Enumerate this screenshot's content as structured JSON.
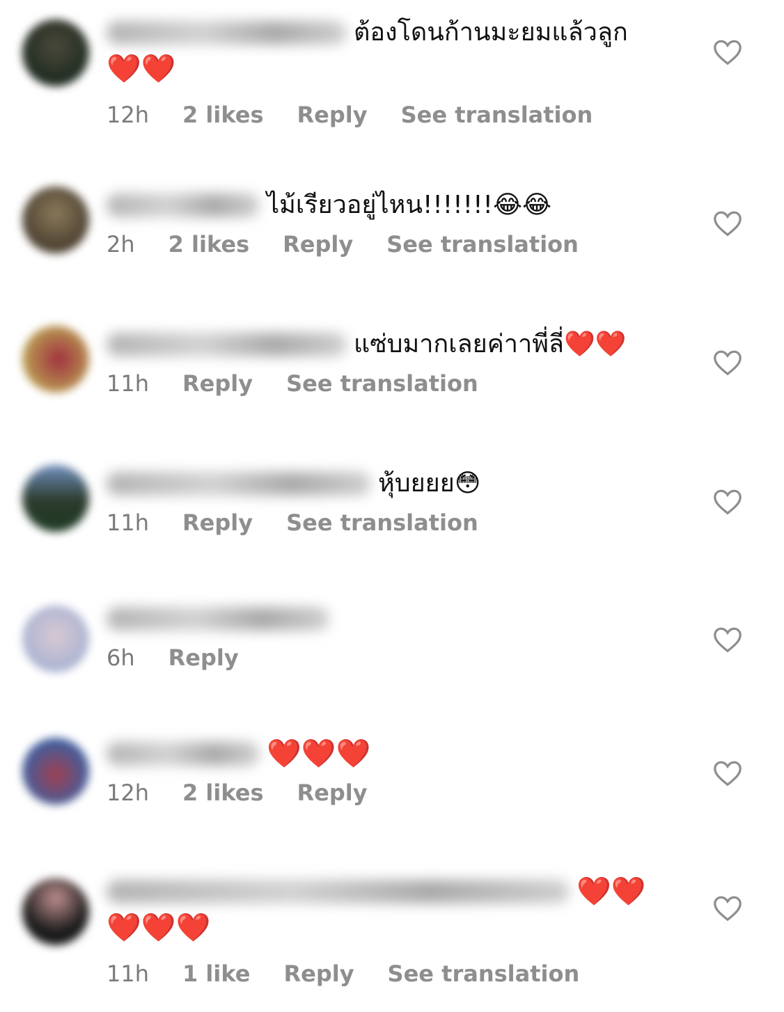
{
  "comments": [
    {
      "text": "ต้องโดนก้านมะยมแล้วลูก",
      "emoji_line": "❤️❤️",
      "time": "12h",
      "likes": "2 likes",
      "reply": "Reply",
      "translate": "See translation"
    },
    {
      "text": "ไม้เรียวอยู่ไหน!!!!!!!😂😂",
      "time": "2h",
      "likes": "2 likes",
      "reply": "Reply",
      "translate": "See translation"
    },
    {
      "text": "แซ่บมากเลยค่าาพี่ลี่❤️❤️",
      "time": "11h",
      "reply": "Reply",
      "translate": "See translation"
    },
    {
      "text": "หุ้บยยย😳",
      "time": "11h",
      "reply": "Reply",
      "translate": "See translation"
    },
    {
      "text": "",
      "time": "6h",
      "reply": "Reply"
    },
    {
      "text": "❤️❤️❤️",
      "time": "12h",
      "likes": "2 likes",
      "reply": "Reply"
    },
    {
      "text": "❤️❤️",
      "emoji_line": "❤️❤️❤️",
      "time": "11h",
      "likes": "1 like",
      "reply": "Reply",
      "translate": "See translation"
    }
  ],
  "icons": {
    "like": "heart-outline-icon"
  },
  "colors": {
    "meta_text": "#8e8e8e",
    "heart_outline": "#8e8e8e",
    "heart_emoji": "#e8151f"
  }
}
